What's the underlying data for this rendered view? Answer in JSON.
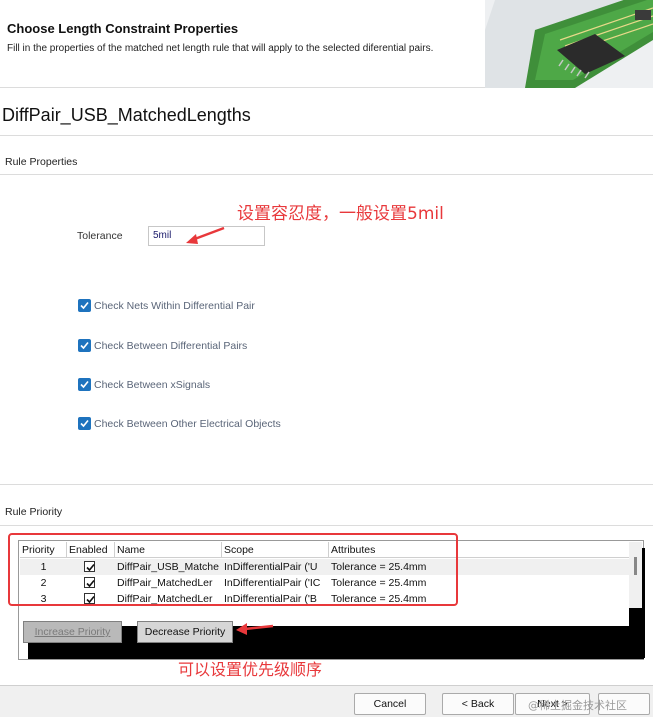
{
  "header": {
    "title": "Choose Length Constraint Properties",
    "description": "Fill in the properties of the matched net length rule that will apply to the selected diferential pairs."
  },
  "rule_name": "DiffPair_USB_MatchedLengths",
  "rule_properties": {
    "section_label": "Rule Properties",
    "tolerance_label": "Tolerance",
    "tolerance_value": "5mil",
    "checks": [
      {
        "label": "Check Nets Within Differential Pair",
        "checked": true
      },
      {
        "label": "Check Between Differential Pairs",
        "checked": true
      },
      {
        "label": "Check Between xSignals",
        "checked": true
      },
      {
        "label": "Check Between Other Electrical Objects",
        "checked": true
      }
    ]
  },
  "annotations": {
    "tolerance_note": "设置容忍度，一般设置5mil",
    "priority_note": "可以设置优先级顺序",
    "accent_color": "#e8383b"
  },
  "rule_priority": {
    "section_label": "Rule Priority",
    "columns": [
      "Priority",
      "Enabled",
      "Name",
      "Scope",
      "Attributes"
    ],
    "rows": [
      {
        "priority": "1",
        "enabled": true,
        "name": "DiffPair_USB_Matche",
        "scope": "InDifferentialPair ('U",
        "attributes": "Tolerance = 25.4mm"
      },
      {
        "priority": "2",
        "enabled": true,
        "name": "DiffPair_MatchedLer",
        "scope": "InDifferentialPair ('IC",
        "attributes": "Tolerance = 25.4mm"
      },
      {
        "priority": "3",
        "enabled": true,
        "name": "DiffPair_MatchedLer",
        "scope": "InDifferentialPair ('B",
        "attributes": "Tolerance = 25.4mm"
      }
    ],
    "increase_label": "Increase Priority",
    "decrease_label": "Decrease Priority"
  },
  "footer": {
    "cancel_label": "Cancel",
    "back_label": "Back",
    "next_label": "Next >",
    "watermark": "@稀土掘金技术社区"
  }
}
